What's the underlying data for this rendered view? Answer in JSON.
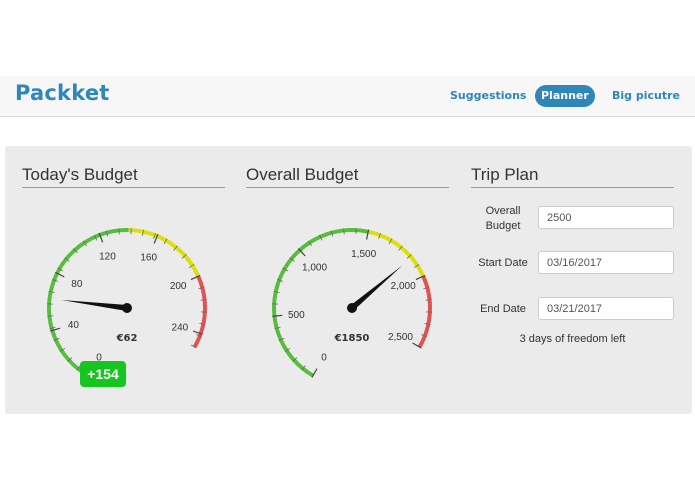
{
  "app": {
    "brand": "Packket",
    "nav": [
      {
        "label": "Suggestions",
        "active": false
      },
      {
        "label": "Planner",
        "active": true
      },
      {
        "label": "Big picutre",
        "active": false
      }
    ],
    "accent_color": "#2e86b9"
  },
  "todays_budget": {
    "title": "Today's Budget",
    "gauge": {
      "min": 0,
      "max": 250,
      "value": 62,
      "value_label": "€62",
      "ticks": [
        "0",
        "40",
        "80",
        "120",
        "160",
        "200",
        "240"
      ],
      "tick_values": [
        0,
        40,
        80,
        120,
        160,
        200,
        240
      ],
      "bands": [
        {
          "from": 0,
          "to": 140,
          "color": "#55bf3b"
        },
        {
          "from": 140,
          "to": 200,
          "color": "#dddf0d"
        },
        {
          "from": 200,
          "to": 250,
          "color": "#df5353"
        }
      ]
    },
    "delta_badge": "+154",
    "delta_color": "#17c51f"
  },
  "overall_budget": {
    "title": "Overall Budget",
    "gauge": {
      "min": 0,
      "max": 2500,
      "value": 1850,
      "value_label": "€1850",
      "ticks": [
        "0",
        "500",
        "1,000",
        "1,500",
        "2,000",
        "2,500"
      ],
      "tick_values": [
        0,
        500,
        1000,
        1500,
        2000,
        2500
      ],
      "bands": [
        {
          "from": 0,
          "to": 1500,
          "color": "#55bf3b"
        },
        {
          "from": 1500,
          "to": 2000,
          "color": "#dddf0d"
        },
        {
          "from": 2000,
          "to": 2500,
          "color": "#df5353"
        }
      ]
    }
  },
  "trip_plan": {
    "title": "Trip Plan",
    "overall_budget_label": "Overall Budget",
    "overall_budget_value": "2500",
    "start_date_label": "Start Date",
    "start_date_value": "03/16/2017",
    "end_date_label": "End Date",
    "end_date_value": "03/21/2017",
    "freedom_text": "3 days of freedom left"
  }
}
